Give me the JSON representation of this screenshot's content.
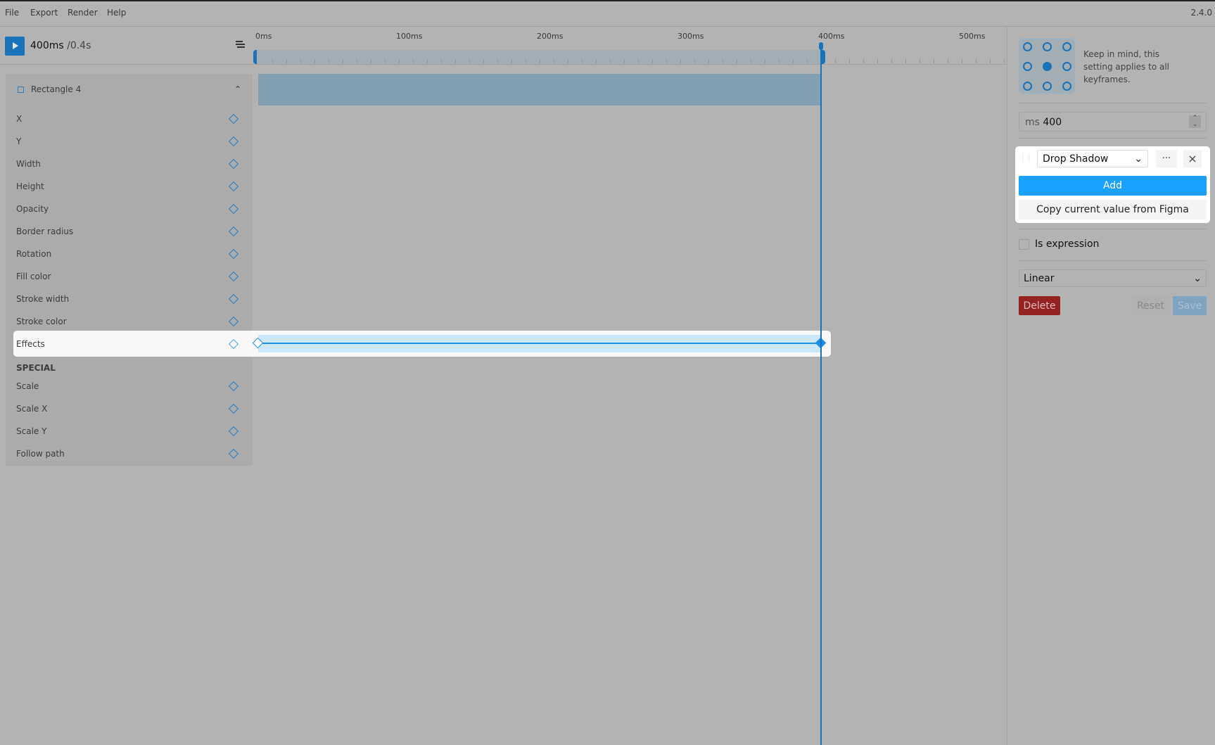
{
  "menu": [
    "File",
    "Export",
    "Render",
    "Help"
  ],
  "version": "2.4.0",
  "header": {
    "time": "400ms",
    "duration": "/0.4s"
  },
  "timeline": {
    "ticks": [
      "0ms",
      "100ms",
      "200ms",
      "300ms",
      "400ms",
      "500ms"
    ],
    "playhead_ms": 400
  },
  "layer": {
    "name": "Rectangle 4"
  },
  "properties": [
    "X",
    "Y",
    "Width",
    "Height",
    "Opacity",
    "Border radius",
    "Rotation",
    "Fill color",
    "Stroke width",
    "Stroke color",
    "Effects"
  ],
  "special_label": "SPECIAL",
  "special": [
    "Scale",
    "Scale X",
    "Scale Y",
    "Follow path"
  ],
  "panel": {
    "note": "Keep in mind, this setting applies to all keyframes.",
    "ms_unit": "ms",
    "ms_value": "400",
    "effect_select": "Drop Shadow",
    "more_label": "···",
    "close_label": "×",
    "add_label": "Add",
    "copy_label": "Copy current value from Figma",
    "is_expression": "Is expression",
    "easing": "Linear",
    "delete_label": "Delete",
    "reset_label": "Reset",
    "save_label": "Save"
  },
  "colors": {
    "accent": "#1a73b8",
    "add": "#1aa0ff",
    "delete": "#962121"
  }
}
